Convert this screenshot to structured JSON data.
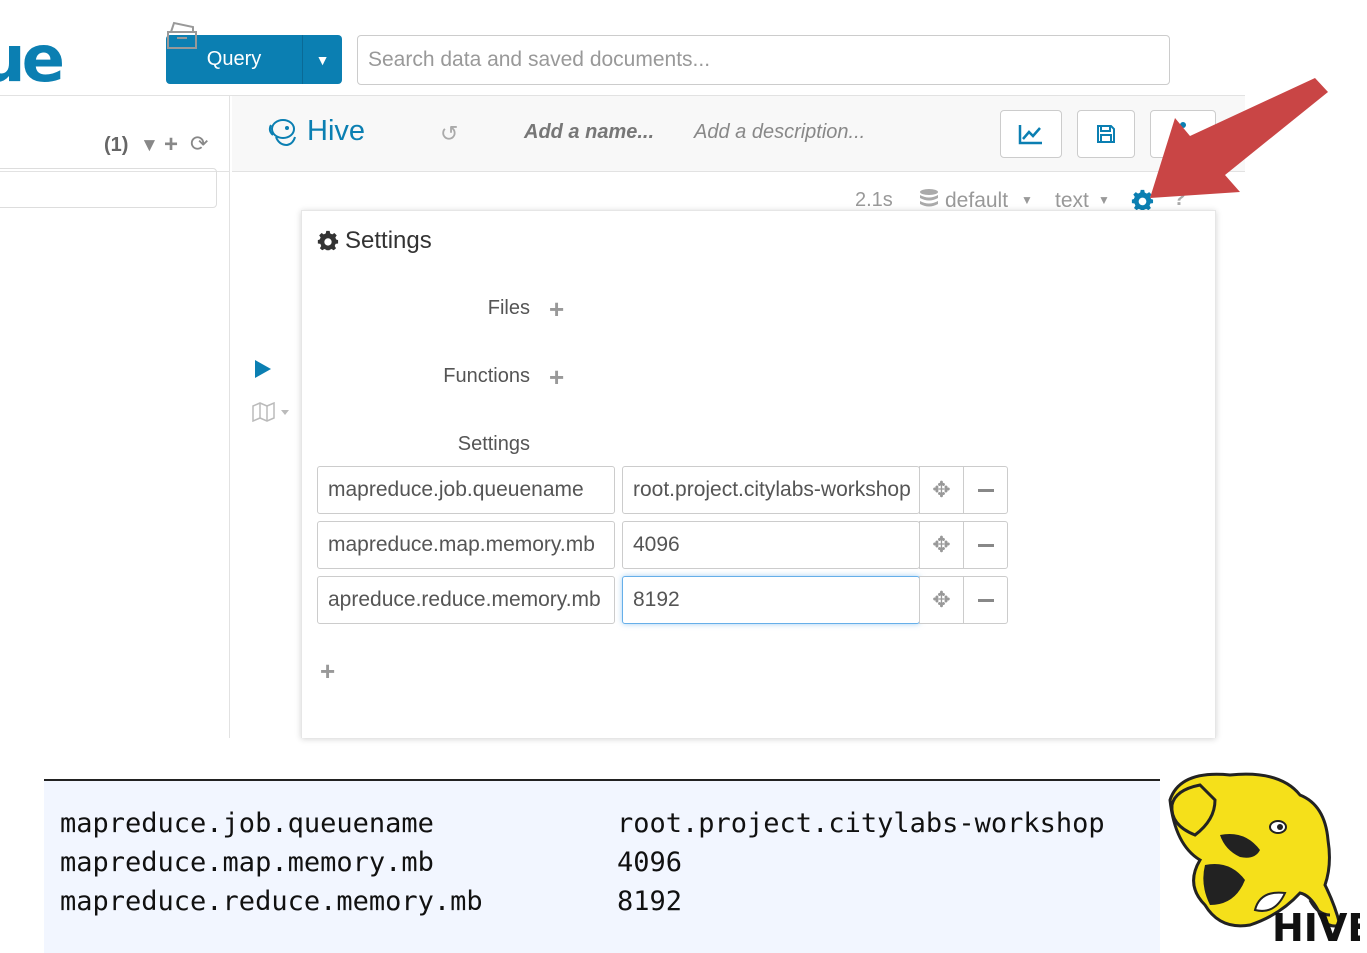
{
  "header": {
    "logo_text": "ue",
    "query_button": "Query",
    "search_placeholder": "Search data and saved documents..."
  },
  "left_panel": {
    "count": "(1)"
  },
  "editor": {
    "engine_title": "Hive",
    "name_placeholder": "Add a name...",
    "description_placeholder": "Add a description...",
    "execution_time": "2.1s",
    "database": "default",
    "format": "text",
    "help": "?"
  },
  "settings_panel": {
    "title": "Settings",
    "files_label": "Files",
    "functions_label": "Functions",
    "settings_label": "Settings",
    "rows": [
      {
        "key": "mapreduce.job.queuename",
        "value": "root.project.citylabs-workshop"
      },
      {
        "key": "mapreduce.map.memory.mb",
        "value": "4096"
      },
      {
        "key": "apreduce.reduce.memory.mb",
        "value": "8192"
      }
    ]
  },
  "code_block": {
    "rows": [
      {
        "key": "mapreduce.job.queuename",
        "value": "root.project.citylabs-workshop"
      },
      {
        "key": "mapreduce.map.memory.mb",
        "value": "4096"
      },
      {
        "key": "mapreduce.reduce.memory.mb",
        "value": "8192"
      }
    ]
  },
  "hive_logo_text": "HIVE",
  "colors": {
    "accent": "#0b7fb2",
    "arrow": "#c94545",
    "code_background": "#f2f6ff",
    "logo_yellow": "#f5e01a"
  }
}
